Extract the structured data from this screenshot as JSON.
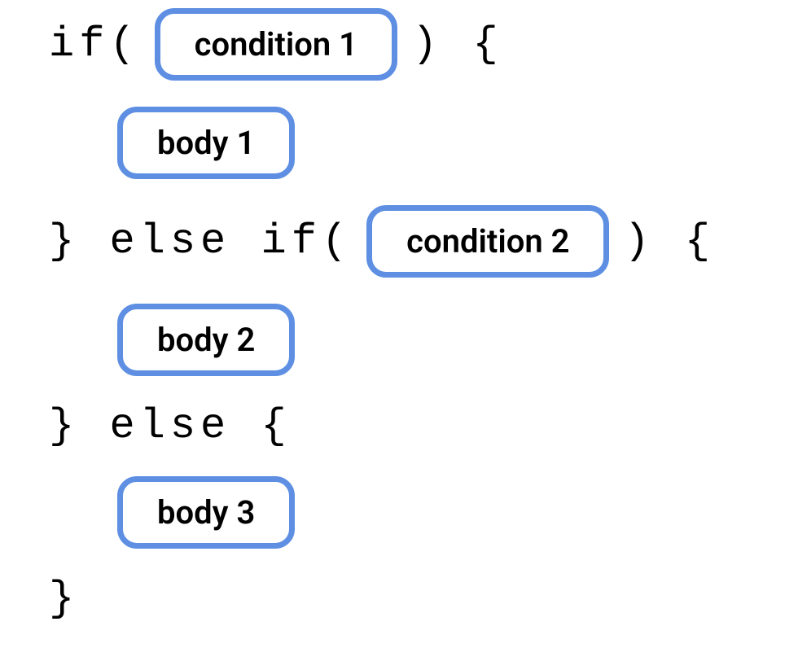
{
  "code": {
    "if_keyword": "if",
    "else_keyword": "else",
    "open_paren": "(",
    "close_paren": ")",
    "open_brace": "{",
    "close_brace": "}"
  },
  "pills": {
    "condition1": "condition 1",
    "body1": "body 1",
    "condition2": "condition 2",
    "body2": "body 2",
    "body3": "body 3"
  },
  "colors": {
    "pill_border": "#5e8fe3",
    "text": "#000000",
    "background": "#ffffff"
  }
}
